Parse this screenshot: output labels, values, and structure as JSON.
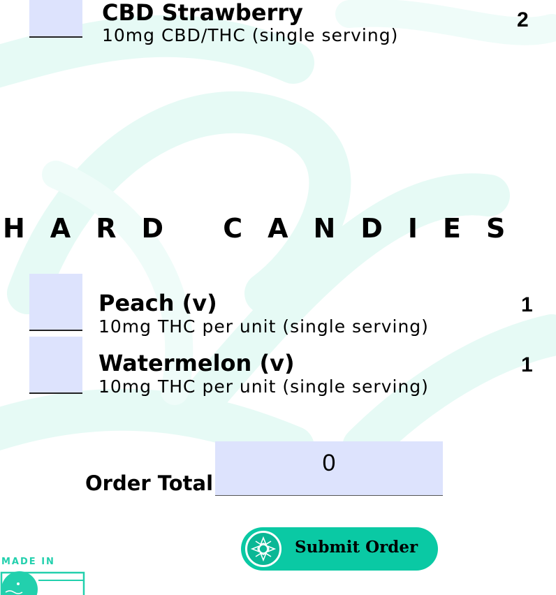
{
  "colors": {
    "accent": "#0ac9a4",
    "input_fill": "#dde3fd",
    "watermark": "#e6faf5"
  },
  "items": [
    {
      "name": "CBD Strawberry",
      "description": "10mg CBD/THC (single serving)",
      "count": "2"
    }
  ],
  "section": {
    "title": "HARD CANDIES"
  },
  "hard_candies": [
    {
      "name": "Peach (v)",
      "description": "10mg THC per unit (single serving)",
      "count": "1"
    },
    {
      "name": "Watermelon (v)",
      "description": "10mg THC per unit (single serving)",
      "count": "1"
    }
  ],
  "order": {
    "total_label": "Order Total",
    "total_value": "0"
  },
  "submit": {
    "label": "Submit Order",
    "icon": "mandala-icon"
  },
  "footer": {
    "made_in": "MADE IN",
    "badge_icon": "state-flag-icon"
  }
}
